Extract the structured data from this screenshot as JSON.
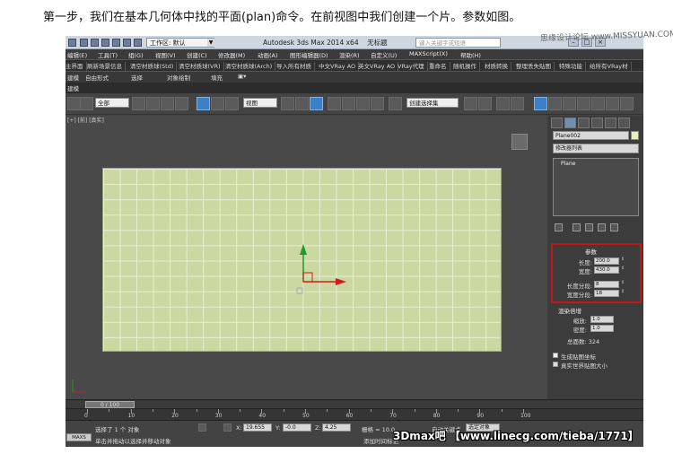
{
  "caption": "第一步，我们在基本几何体中找的平面(plan)命令。在前视图中我们创建一个片。参数如图。",
  "titlebar": {
    "workspace": "工作区: 默认",
    "app_title": "Autodesk 3ds Max  2014 x64",
    "file_title": "无标题",
    "search_placeholder": "键入关键字或短语"
  },
  "menus": [
    "编辑(E)",
    "工具(T)",
    "组(G)",
    "视图(V)",
    "创建(C)",
    "修改器(M)",
    "动画(A)",
    "图形编辑器(D)",
    "渲染(R)",
    "自定义(U)",
    "MAXScript(X)",
    "帮助(H)"
  ],
  "plugins": [
    "主界面",
    "刷新场景信息",
    "清空材质球(Std)",
    "清空材质球(VR)",
    "清空材质球(Arch)",
    "导入所有材质",
    "中文VRay AO",
    "英文VRay AO",
    "VRay代理",
    "重命名",
    "随机操作",
    "材质转换",
    "整理丢失贴图",
    "特殊功能",
    "给所有VRay材"
  ],
  "ribbon_tabs": [
    "建模",
    "自由形式",
    "选择",
    "对象绘制",
    "填充"
  ],
  "ribbon_sub": "建模",
  "toolbar": {
    "selection_filter": "全部",
    "view_dropdown": "视图",
    "named_selection": "创建选择集"
  },
  "viewport": {
    "label": "[+] [前] [真实]"
  },
  "command_panel": {
    "object_name": "Plane002",
    "modifier_list": "修改器列表",
    "stack_item": "Plane",
    "params_title": "参数",
    "params": [
      {
        "label": "长度:",
        "value": "200.0"
      },
      {
        "label": "宽度:",
        "value": "430.0"
      }
    ],
    "segs": [
      {
        "label": "长度分段:",
        "value": "8"
      },
      {
        "label": "宽度分段:",
        "value": "18"
      }
    ],
    "render_title": "渲染倍增",
    "render_params": [
      {
        "label": "缩放:",
        "value": "1.0"
      },
      {
        "label": "密度:",
        "value": "1.0"
      }
    ],
    "total_faces": "总面数: 324",
    "check1": "生成贴图坐标",
    "check2": "真实世界贴图大小"
  },
  "timeline": {
    "frame": "0 / 100",
    "ruler_nums": [
      "0",
      "10",
      "20",
      "30",
      "40",
      "50",
      "60",
      "70",
      "80",
      "90",
      "100"
    ]
  },
  "status": {
    "selection": "选择了 1 个 对象",
    "hint": "单击并拖动以选择并移动对象",
    "x_label": "X:",
    "x_value": "19.655",
    "y_label": "Y:",
    "y_value": "-0.0",
    "z_label": "Z:",
    "z_value": "4.25",
    "grid": "栅格 = 10.0",
    "autokey": "自动关键点",
    "selected_dd": "选定对象",
    "addtime": "添加时间标记",
    "maxscript": "MAXS"
  },
  "watermarks": {
    "bottom": "3Dmax吧 【www.linecg.com/tieba/1771】",
    "top_right": "思缘设计论坛 www.MISSYUAN.COM"
  },
  "colors": {
    "plane_fill": "#cbd8a2",
    "highlight_border": "#c41818",
    "axis_y": "#1e9a2a",
    "axis_x": "#d01c1c"
  }
}
